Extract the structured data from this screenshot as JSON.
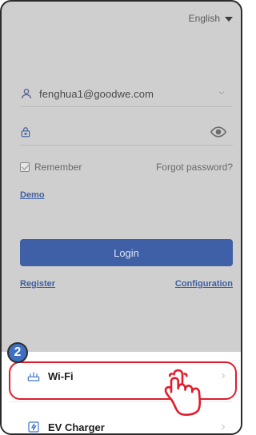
{
  "language": {
    "label": "English"
  },
  "login": {
    "account_value": "fenghua1@goodwe.com",
    "remember_label": "Remember",
    "forgot_label": "Forgot password?",
    "demo_label": "Demo",
    "login_label": "Login",
    "register_label": "Register",
    "configuration_label": "Configuration"
  },
  "sheet": {
    "items": [
      {
        "label": "Wi-Fi",
        "icon": "router-icon"
      },
      {
        "label": "EV Charger",
        "icon": "ev-charger-icon"
      }
    ]
  },
  "annotation": {
    "step_number": "2"
  },
  "colors": {
    "accent": "#3f5fa6",
    "highlight": "#e11d2d"
  }
}
